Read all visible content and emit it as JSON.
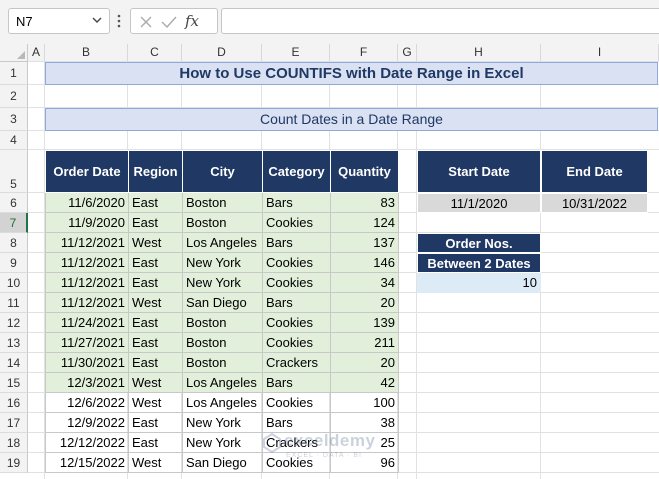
{
  "name_box": "N7",
  "fx_label": "fx",
  "formula": "",
  "columns": [
    "A",
    "B",
    "C",
    "D",
    "E",
    "F",
    "G",
    "H",
    "I"
  ],
  "rows": [
    "1",
    "2",
    "3",
    "4",
    "5",
    "6",
    "7",
    "8",
    "9",
    "10",
    "11",
    "12",
    "13",
    "14",
    "15",
    "16",
    "17",
    "18",
    "19"
  ],
  "title": "How to Use COUNTIFS with Date Range in Excel",
  "subtitle": "Count Dates in a Date Range",
  "table": {
    "headers": [
      "Order Date",
      "Region",
      "City",
      "Category",
      "Quantity"
    ],
    "rows": [
      [
        "11/6/2020",
        "East",
        "Boston",
        "Bars",
        "83"
      ],
      [
        "11/9/2020",
        "East",
        "Boston",
        "Cookies",
        "124"
      ],
      [
        "11/12/2021",
        "West",
        "Los Angeles",
        "Bars",
        "137"
      ],
      [
        "11/12/2021",
        "East",
        "New York",
        "Cookies",
        "146"
      ],
      [
        "11/12/2021",
        "East",
        "New York",
        "Cookies",
        "34"
      ],
      [
        "11/12/2021",
        "West",
        "San Diego",
        "Bars",
        "20"
      ],
      [
        "11/24/2021",
        "East",
        "Boston",
        "Cookies",
        "139"
      ],
      [
        "11/27/2021",
        "East",
        "Boston",
        "Cookies",
        "211"
      ],
      [
        "11/30/2021",
        "East",
        "Boston",
        "Crackers",
        "20"
      ],
      [
        "12/3/2021",
        "West",
        "Los Angeles",
        "Bars",
        "42"
      ],
      [
        "12/6/2022",
        "West",
        "Los Angeles",
        "Cookies",
        "100"
      ],
      [
        "12/9/2022",
        "East",
        "New York",
        "Bars",
        "38"
      ],
      [
        "12/12/2022",
        "East",
        "New York",
        "Crackers",
        "25"
      ],
      [
        "12/15/2022",
        "West",
        "San Diego",
        "Cookies",
        "96"
      ]
    ],
    "highlighted_rows": 10
  },
  "criteria": {
    "start_label": "Start Date",
    "end_label": "End Date",
    "start_value": "11/1/2020",
    "end_value": "10/31/2022"
  },
  "result": {
    "label_line1": "Order Nos.",
    "label_line2": "Between 2 Dates",
    "value": "10"
  },
  "watermark": {
    "brand": "exceldemy",
    "tagline": "EXCEL · DATA · BI"
  },
  "colors": {
    "header_fill": "#203864",
    "title_fill": "#d9e1f2",
    "highlight_fill": "#e2efda",
    "result_fill": "#ddebf7",
    "criteria_fill": "#d9d9d9"
  }
}
